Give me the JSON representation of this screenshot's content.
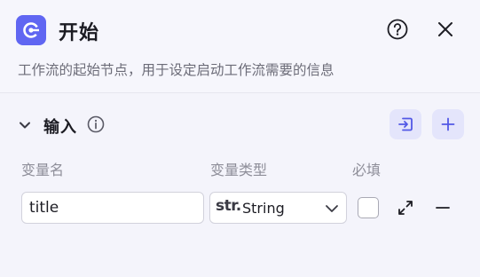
{
  "header": {
    "title": "开始",
    "description": "工作流的起始节点，用于设定启动工作流需要的信息",
    "icons": {
      "node": "start-node-icon",
      "help": "question-circle-icon",
      "close": "close-icon"
    },
    "accent_color": "#6066f2"
  },
  "inputs_section": {
    "title": "输入",
    "icons": {
      "toggle": "chevron-down-icon",
      "info": "info-circle-icon",
      "import": "import-icon",
      "add": "plus-icon"
    },
    "columns": {
      "name": "变量名",
      "type": "变量类型",
      "required": "必填"
    },
    "rows": [
      {
        "name": "title",
        "type_prefix": "str.",
        "type": "String",
        "required": false
      }
    ]
  }
}
